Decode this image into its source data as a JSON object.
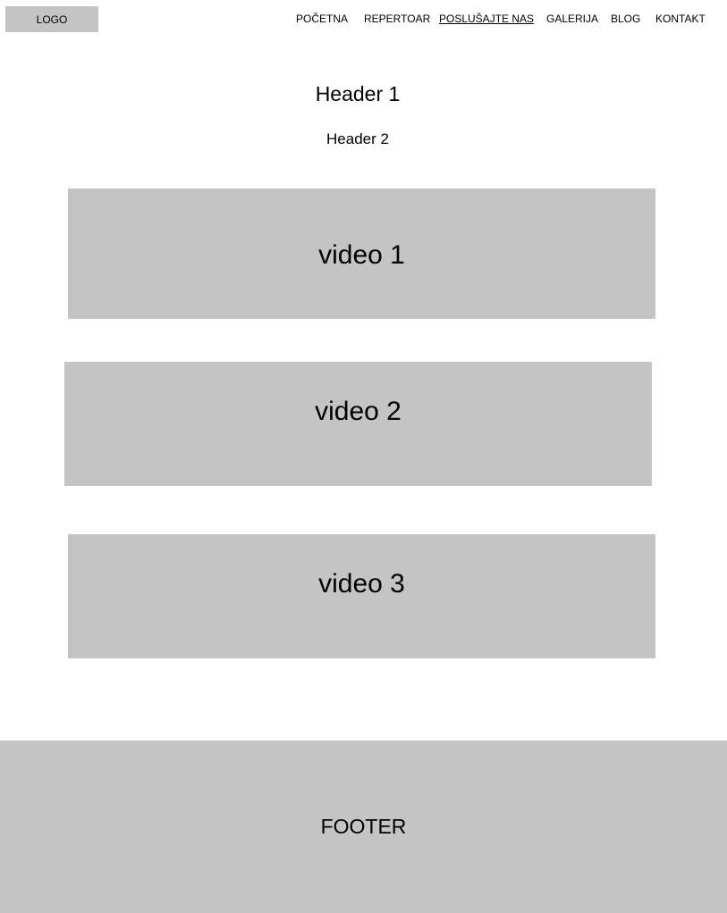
{
  "header": {
    "logo": "LOGO",
    "nav": [
      {
        "label": "POČETNA"
      },
      {
        "label": "REPERTOAR"
      },
      {
        "label": "POSLUŠAJTE NAS",
        "active": true
      },
      {
        "label": "GALERIJA"
      },
      {
        "label": "BLOG"
      },
      {
        "label": "KONTAKT"
      }
    ]
  },
  "main": {
    "header1": "Header 1",
    "header2": "Header 2",
    "videos": [
      {
        "label": "video 1"
      },
      {
        "label": "video 2"
      },
      {
        "label": "video 3"
      }
    ]
  },
  "footer": {
    "label": "FOOTER"
  },
  "colors": {
    "placeholder": "#c4c4c4",
    "background": "#ffffff",
    "text": "#000000"
  }
}
